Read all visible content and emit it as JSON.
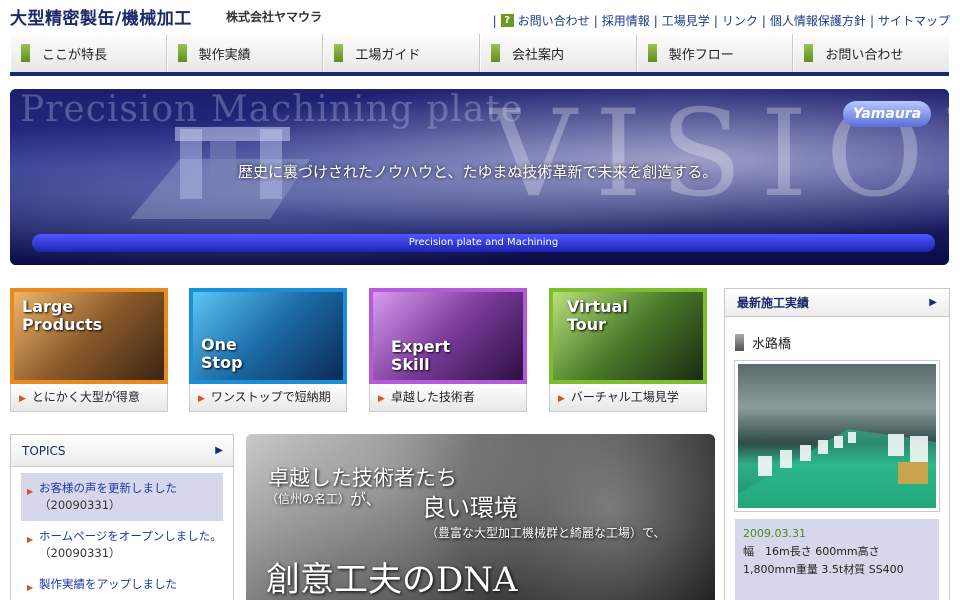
{
  "header": {
    "site_title": "大型精密製缶/機械加工",
    "company": "株式会社ヤマウラ",
    "links": [
      "お問い合わせ",
      "採用情報",
      "工場見学",
      "リンク",
      "個人情報保護方針",
      "サイトマップ"
    ]
  },
  "nav": [
    "ここが特長",
    "製作実績",
    "工場ガイド",
    "会社案内",
    "製作フロー",
    "お問い合わせ"
  ],
  "hero": {
    "bg_text": "Precision Machining plate",
    "vision_text": "VISION",
    "tagline": "歴史に裏づけされたノウハウと、たゆまぬ技術革新で未来を創造する。",
    "logo": "Yamaura",
    "bar_text": "Precision plate and Machining"
  },
  "features": [
    {
      "title_line1": "Large",
      "title_line2": "Products",
      "caption": "とにかく大型が得意",
      "color": "#e98a1f"
    },
    {
      "title_line1": "One",
      "title_line2": "Stop",
      "caption": "ワンストップで短納期",
      "color": "#1b8fd6"
    },
    {
      "title_line1": "Expert",
      "title_line2": "Skill",
      "caption": "卓越した技術者",
      "color": "#b55ad8"
    },
    {
      "title_line1": "Virtual",
      "title_line2": "Tour",
      "caption": "バーチャル工場見学",
      "color": "#7cbf2a"
    }
  ],
  "topics": {
    "title": "TOPICS",
    "items": [
      {
        "text": "お客様の声を更新しました",
        "date": "（20090331）"
      },
      {
        "text": "ホームページをオープンしました。",
        "date": "（20090331）"
      },
      {
        "text": "製作実績をアップしました",
        "date": ""
      }
    ]
  },
  "dna": {
    "line1": "卓越した技術者たち",
    "line2a": "（信州の名工）",
    "line2b": "が、",
    "line2c": "良い環境",
    "line3": "（豊富な大型加工機械群と綺麗な工場）で、",
    "line4": "創意工夫のDNA"
  },
  "latest": {
    "title": "最新施工実績",
    "work_title": "水路橋",
    "date": "2009.03.31",
    "spec": "幅　16m長さ 600mm高さ 1,800mm重量 3.5t材質 SS400"
  }
}
